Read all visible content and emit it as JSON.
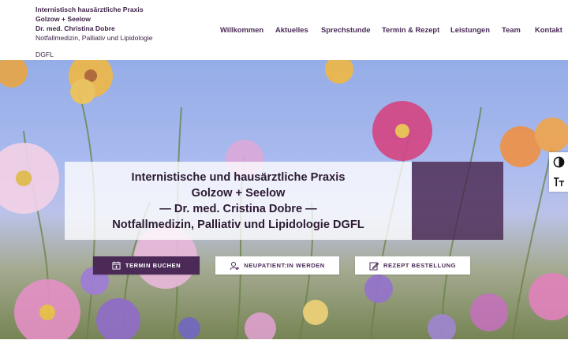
{
  "header": {
    "brand_lines": [
      "Internistisch hausärztliche Praxis",
      "Golzow + Seelow",
      "Dr. med. Christina Dobre",
      "Notfallmedizin, Palliativ und Lipidologie",
      "DGFL"
    ],
    "nav": [
      "Willkommen",
      "Aktuelles",
      "Sprechstunde",
      "Termin & Rezept",
      "Leistungen",
      "Team",
      "Kontakt"
    ]
  },
  "hero": {
    "title_lines": [
      "Internistische und hausärztliche Praxis",
      "Golzow + Seelow",
      "— Dr. med. Cristina Dobre —",
      "Notfallmedizin, Palliativ und Lipidologie DGFL"
    ],
    "buttons": [
      {
        "label": "TERMIN BUCHEN",
        "icon": "calendar-plus-icon"
      },
      {
        "label": "NEUPATIENT:IN WERDEN",
        "icon": "user-add-icon"
      },
      {
        "label": "REZEPT BESTELLUNG",
        "icon": "edit-icon"
      }
    ]
  },
  "accessibility_toolbar": {
    "items": [
      {
        "icon": "contrast-icon"
      },
      {
        "icon": "text-size-icon"
      }
    ]
  },
  "colors": {
    "brand": "#4b2a57",
    "overlay": "#ffffff",
    "accent_box": "#4a2852"
  }
}
